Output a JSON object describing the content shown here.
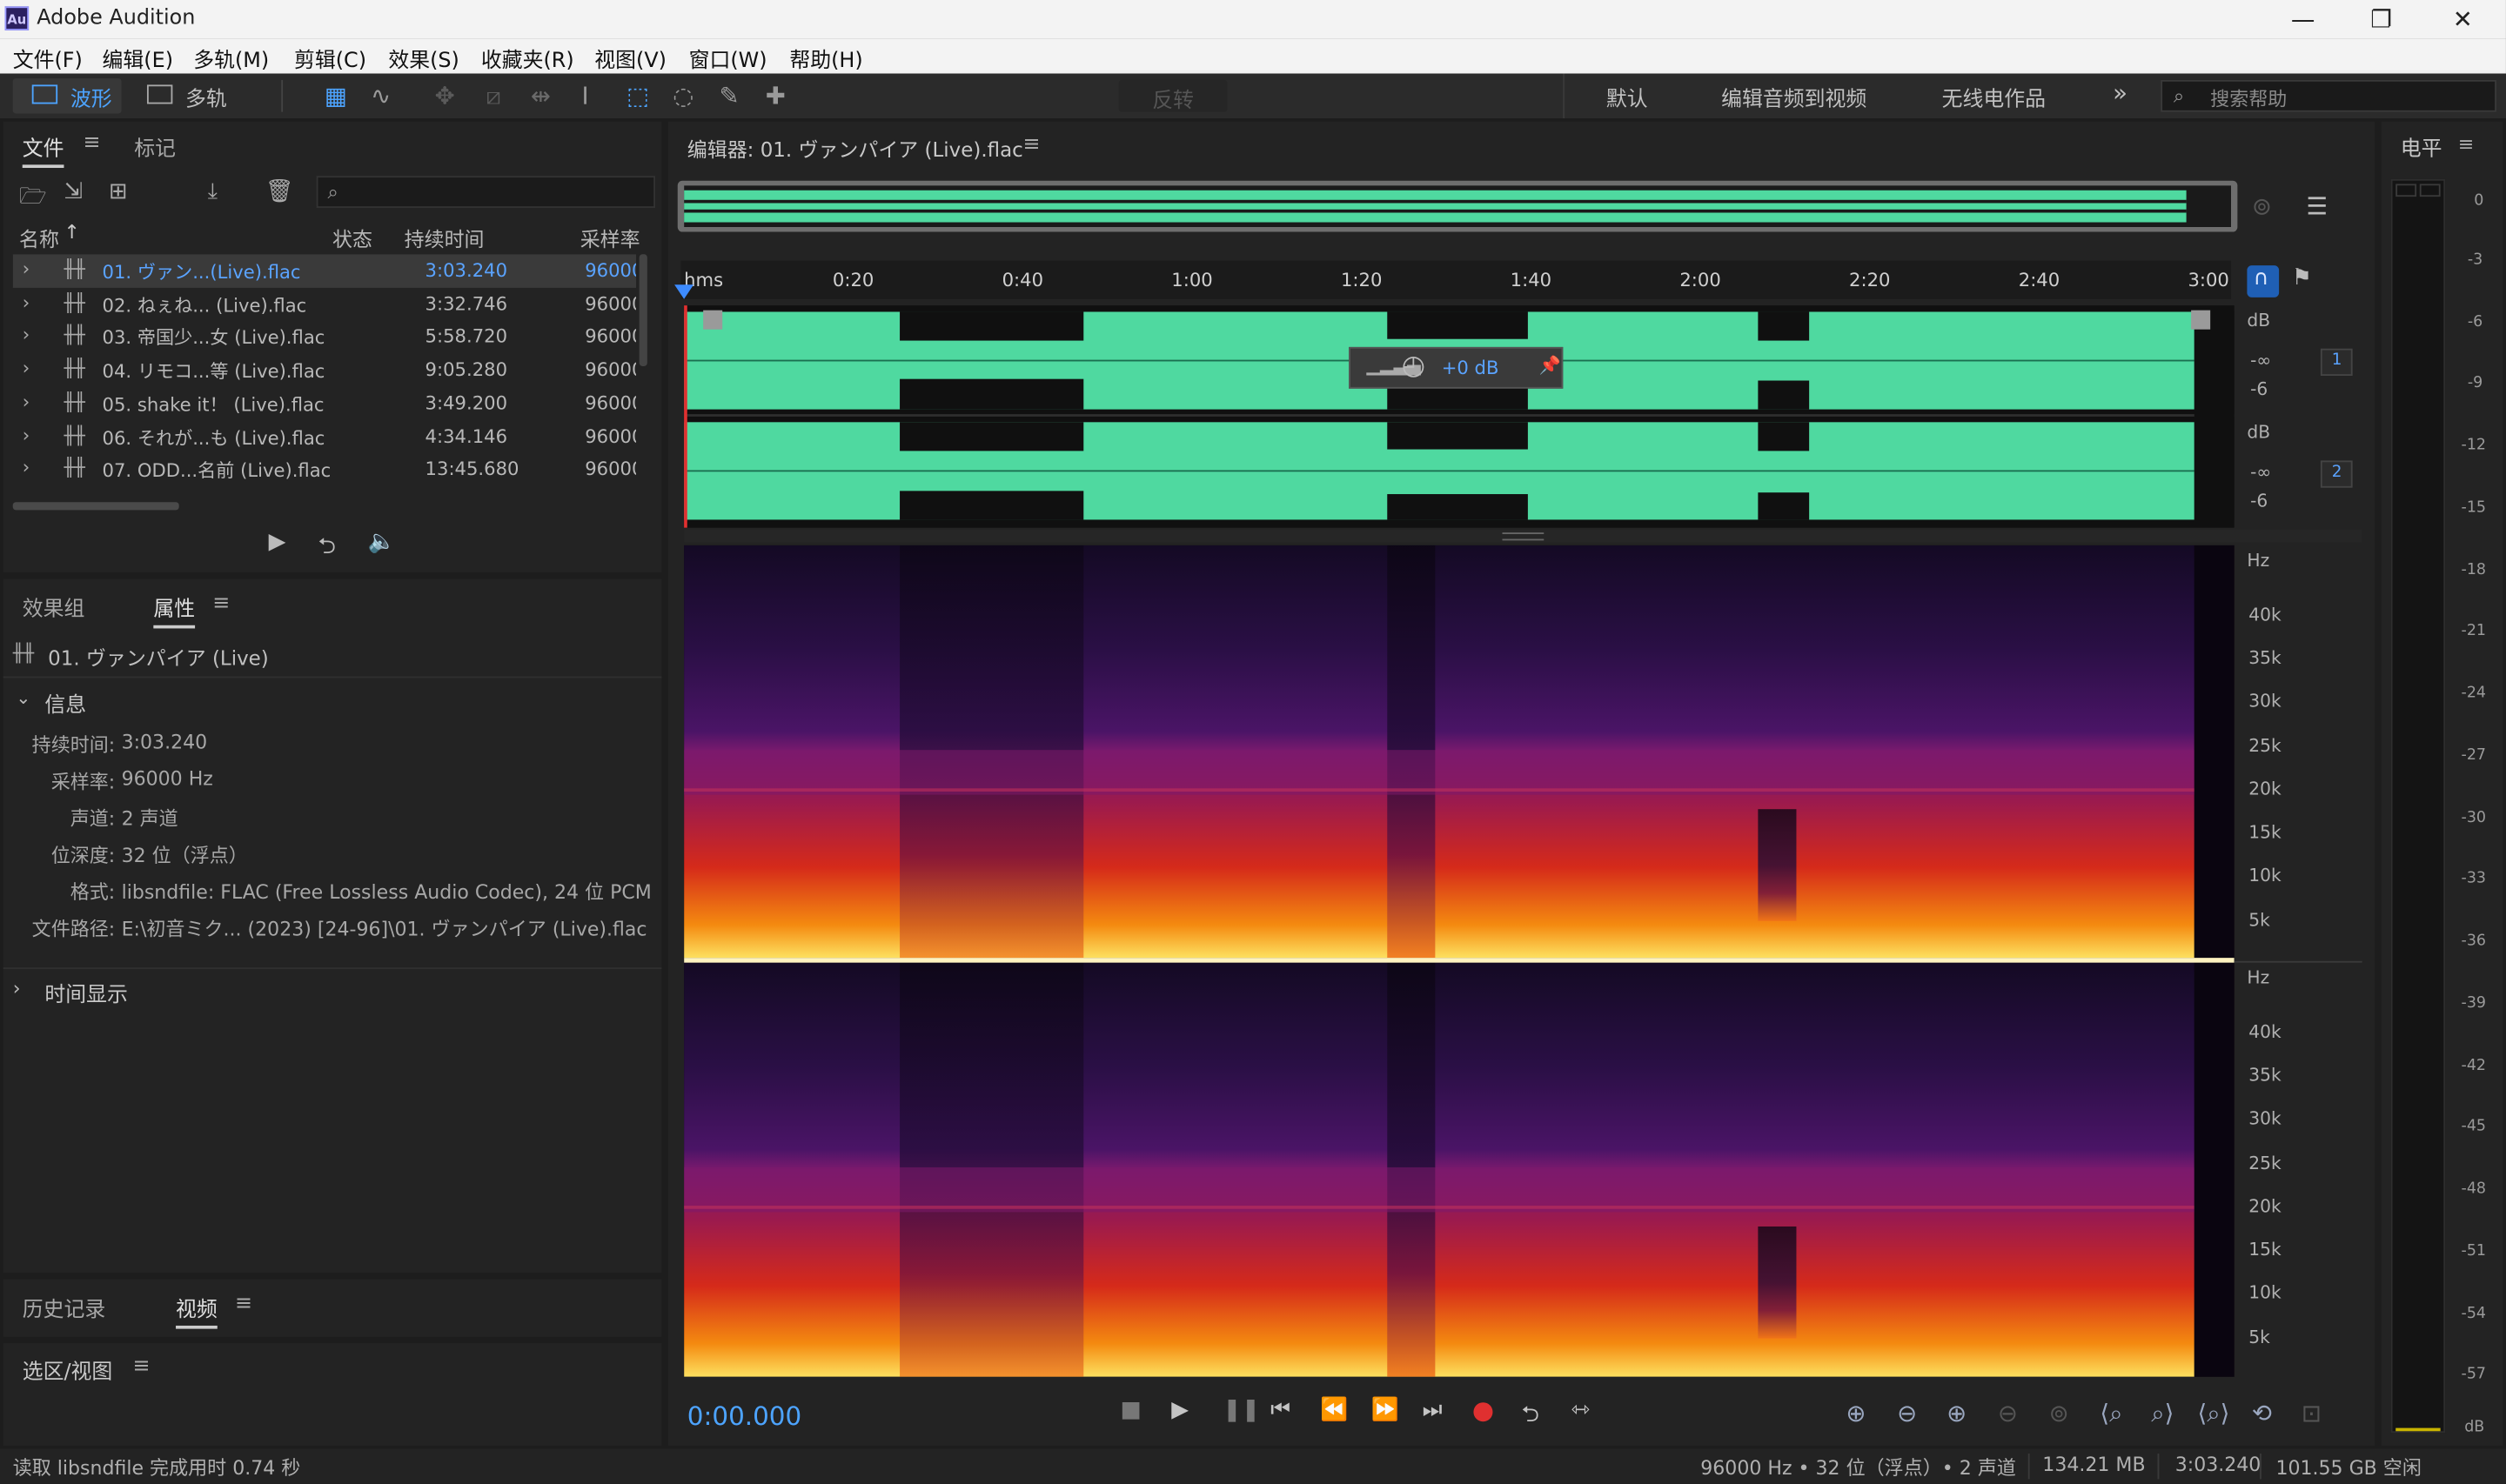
{
  "window": {
    "title": "Adobe Audition",
    "logo_text": "Au",
    "minimize": "—",
    "restore": "❐",
    "close": "✕"
  },
  "menu": [
    "文件(F)",
    "编辑(E)",
    "多轨(M)",
    "剪辑(C)",
    "效果(S)",
    "收藏夹(R)",
    "视图(V)",
    "窗口(W)",
    "帮助(H)"
  ],
  "toolbar": {
    "waveform_label": "波形",
    "multitrack_label": "多轨",
    "reverse_label": "反转",
    "more": "»"
  },
  "workspaces": [
    "默认",
    "编辑音频到视频",
    "无线电作品"
  ],
  "search": {
    "placeholder": "搜索帮助"
  },
  "files_panel": {
    "tabs": [
      "文件",
      "标记"
    ],
    "columns": [
      "名称",
      "状态",
      "持续时间",
      "采样率"
    ],
    "sort_arrow": "↑",
    "files": [
      {
        "name": "01. ヴァン...(Live).flac",
        "duration": "3:03.240",
        "rate": "96000"
      },
      {
        "name": "02. ねぇね... (Live).flac",
        "duration": "3:32.746",
        "rate": "96000"
      },
      {
        "name": "03. 帝国少...女 (Live).flac",
        "duration": "5:58.720",
        "rate": "96000"
      },
      {
        "name": "04. リモコ...等 (Live).flac",
        "duration": "9:05.280",
        "rate": "96000"
      },
      {
        "name": "05. shake it！ (Live).flac",
        "duration": "3:49.200",
        "rate": "96000"
      },
      {
        "name": "06. それが...も (Live).flac",
        "duration": "4:34.146",
        "rate": "96000"
      },
      {
        "name": "07. ODD...名前 (Live).flac",
        "duration": "13:45.680",
        "rate": "96000"
      }
    ]
  },
  "props_panel": {
    "tabs": [
      "效果组",
      "属性"
    ],
    "file_title": "01. ヴァンパイア (Live)",
    "info_section": "信息",
    "info": [
      {
        "label": "持续时间:",
        "value": "3:03.240"
      },
      {
        "label": "采样率:",
        "value": "96000 Hz"
      },
      {
        "label": "声道:",
        "value": "2 声道"
      },
      {
        "label": "位深度:",
        "value": "32 位（浮点）"
      },
      {
        "label": "格式:",
        "value": "libsndfile: FLAC (Free Lossless Audio Codec), 24 位 PCM"
      },
      {
        "label": "文件路径:",
        "value": "E:\\初音ミク... (2023) [24-96]\\01. ヴァンパイア (Live).flac"
      }
    ],
    "time_section": "时间显示"
  },
  "bottom_panels": {
    "history_tab": "历史记录",
    "video_tab": "视频",
    "selection_tab": "选区/视图"
  },
  "editor": {
    "title": "编辑器: 01. ヴァンパイア (Live).flac",
    "ruler_unit": "hms",
    "ruler_labels": [
      "0:20",
      "0:40",
      "1:00",
      "1:20",
      "1:40",
      "2:00",
      "2:20",
      "2:40",
      "3:00"
    ],
    "db_unit": "dB",
    "db_labels": [
      "-∞",
      "-6"
    ],
    "channels": [
      "1",
      "2"
    ],
    "hz_unit": "Hz",
    "hz_labels": [
      "40k",
      "35k",
      "30k",
      "25k",
      "20k",
      "15k",
      "10k",
      "5k"
    ],
    "hud_gain": "+0 dB",
    "current_time": "0:00.000",
    "colors": {
      "waveform": "#4fd9a0",
      "waveform_bg": "#101010",
      "accent": "#3d8bff",
      "record": "#e03030"
    }
  },
  "level_meter": {
    "title": "电平",
    "labels": [
      "0",
      "-3",
      "-6",
      "-9",
      "-12",
      "-15",
      "-18",
      "-21",
      "-24",
      "-27",
      "-30",
      "-33",
      "-36",
      "-39",
      "-42",
      "-45",
      "-48",
      "-51",
      "-54",
      "-57",
      "dB"
    ]
  },
  "status_bar": {
    "left": "读取 libsndfile 完成用时 0.74 秒",
    "sample_rate": "96000 Hz • 32 位（浮点）• 2 声道",
    "size": "134.21 MB",
    "duration": "3:03.240",
    "free_space": "101.55 GB 空闲"
  }
}
